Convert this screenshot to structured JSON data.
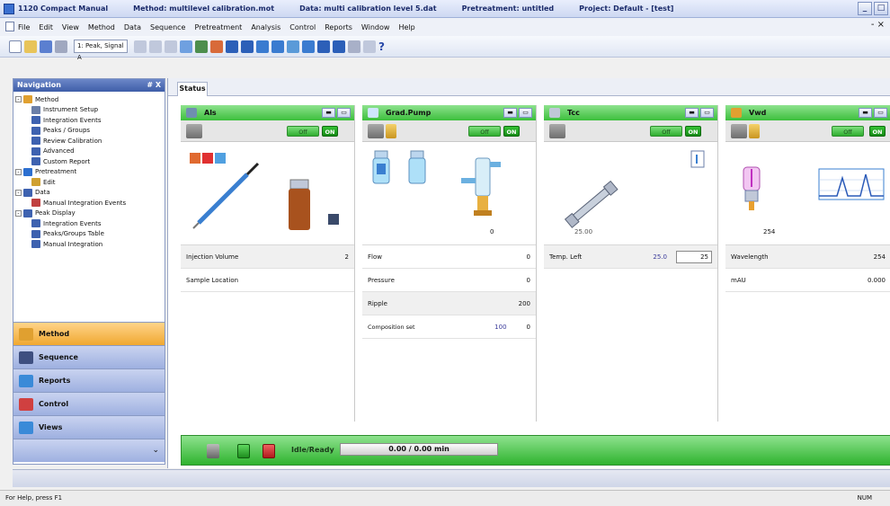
{
  "window": {
    "title_parts": [
      "1120 Compact Manual",
      "Method: multilevel calibration.mot",
      "Data: multi calibration level 5.dat",
      "Pretreatment: untitled",
      "Project: Default - [test]"
    ]
  },
  "menu": [
    "File",
    "Edit",
    "View",
    "Method",
    "Data",
    "Sequence",
    "Pretreatment",
    "Analysis",
    "Control",
    "Reports",
    "Window",
    "Help"
  ],
  "toolbar": {
    "signal_select": "1: Peak, Signal A"
  },
  "navigation": {
    "title": "Navigation",
    "pin_label": "# X",
    "tree": [
      {
        "label": "Method",
        "level": 0,
        "expand": "-"
      },
      {
        "label": "Instrument Setup",
        "level": 1
      },
      {
        "label": "Integration Events",
        "level": 1
      },
      {
        "label": "Peaks / Groups",
        "level": 1
      },
      {
        "label": "Review Calibration",
        "level": 1
      },
      {
        "label": "Advanced",
        "level": 1
      },
      {
        "label": "Custom Report",
        "level": 1
      },
      {
        "label": "Pretreatment",
        "level": 0,
        "expand": "-"
      },
      {
        "label": "Edit",
        "level": 1
      },
      {
        "label": "Data",
        "level": 0,
        "expand": "-"
      },
      {
        "label": "Manual Integration Events",
        "level": 1
      },
      {
        "label": "Peak Display",
        "level": 0,
        "expand": "-"
      },
      {
        "label": "Integration Events",
        "level": 1
      },
      {
        "label": "Peaks/Groups Table",
        "level": 1
      },
      {
        "label": "Manual Integration",
        "level": 1
      }
    ],
    "sections": [
      "Method",
      "Sequence",
      "Reports",
      "Control",
      "Views"
    ]
  },
  "tab": "Status",
  "modules": [
    {
      "name": "Als",
      "params": [
        {
          "label": "Injection Volume",
          "value": "2"
        },
        {
          "label": "Sample Location",
          "value": ""
        }
      ]
    },
    {
      "name": "Grad.Pump",
      "params": [
        {
          "label": "Flow",
          "value": "0"
        },
        {
          "label": "Pressure",
          "value": "0"
        },
        {
          "label": "Ripple",
          "value": "200"
        },
        {
          "label": "Composition set",
          "value": "100"
        }
      ],
      "pump_value": "0"
    },
    {
      "name": "Tcc",
      "params": [
        {
          "label": "Temp. Left",
          "value": "25.0"
        }
      ],
      "temp_box": "25",
      "col_temp": "25.00"
    },
    {
      "name": "Vwd",
      "params": [
        {
          "label": "Wavelength",
          "value": "254"
        },
        {
          "label": "mAU",
          "value": "0.000"
        }
      ],
      "lamp_value": "254"
    }
  ],
  "pill_labels": {
    "off": "Off",
    "on": "ON"
  },
  "system": {
    "status_label": "Idle/Ready",
    "progress_text": "0.00 / 0.00 min"
  },
  "statusbar": {
    "help": "For Help, press F1",
    "mode": "NUM"
  }
}
